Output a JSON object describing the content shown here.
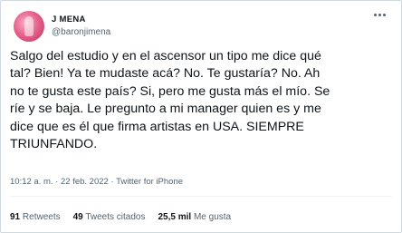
{
  "author": {
    "display_name": "J MENA",
    "handle": "@baronjimena"
  },
  "tweet": {
    "text": "Salgo del estudio y en el ascensor un tipo me dice qué\ntal? Bien! Ya te mudaste acá? No. Te gustaría? No. Ah\nno te gusta este país? Si, pero me gusta más el mío. Se\nríe y se baja. Le pregunto a mi manager quien es y me\ndice que es él que firma artistas en USA. SIEMPRE\nTRIUNFANDO.",
    "time": "10:12 a. m.",
    "separator": " · ",
    "date": "22 feb. 2022",
    "source": "Twitter for iPhone"
  },
  "stats": {
    "retweets_count": "91",
    "retweets_label": "Retweets",
    "quotes_count": "49",
    "quotes_label": "Tweets citados",
    "likes_count": "25,5 mil",
    "likes_label": "Me gusta"
  },
  "icons": {
    "more": "more-options-icon",
    "avatar": "profile-avatar"
  }
}
